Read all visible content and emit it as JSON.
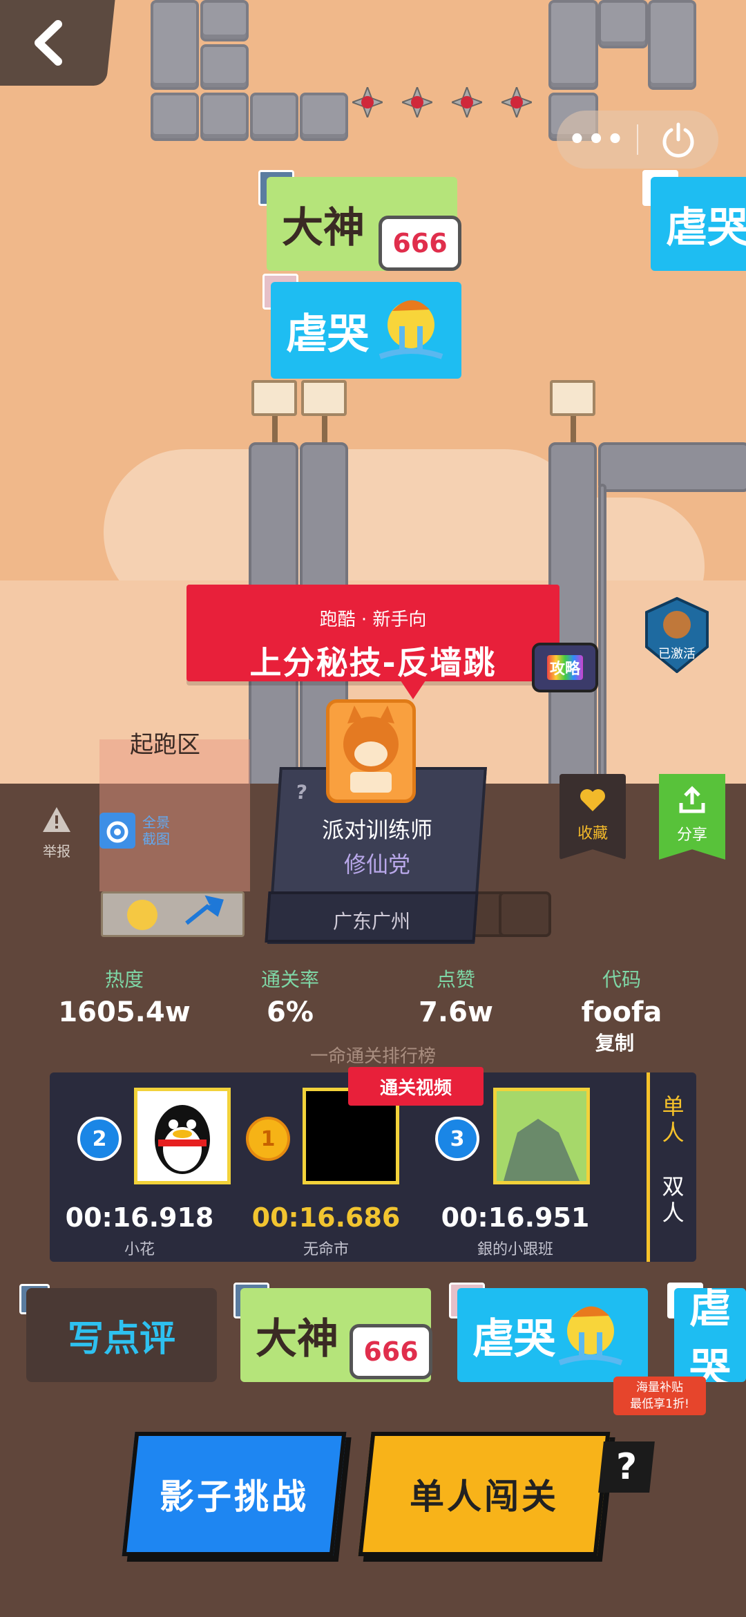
{
  "scene": {
    "start_zone_label": "起跑区",
    "danmu": [
      {
        "text": "大神",
        "sticker": "666",
        "style": "green"
      },
      {
        "text": "虐哭",
        "style": "cyan"
      },
      {
        "text": "虐哭",
        "style": "cyan"
      }
    ],
    "banner": {
      "subtitle": "跑酷 · 新手向",
      "title": "上分秘技-反墙跳"
    },
    "tv_label": "攻略",
    "activated_badge": "已激活"
  },
  "capsule": {
    "more": "•••"
  },
  "tools": {
    "report_label": "举报",
    "screenshot_label_1": "全景",
    "screenshot_label_2": "截图"
  },
  "creator": {
    "unknown_mark": "?",
    "name": "派对训练师",
    "team": "修仙党",
    "location": "广东广州"
  },
  "actions": {
    "favorite_label": "收藏",
    "share_label": "分享"
  },
  "stats": [
    {
      "key": "热度",
      "value": "1605.4w"
    },
    {
      "key": "通关率",
      "value": "6%"
    },
    {
      "key": "点赞",
      "value": "7.6w"
    },
    {
      "key": "代码",
      "value": "foofa"
    }
  ],
  "copy_label": "复制",
  "ranking": {
    "title": "一命通关排行榜",
    "video_tag": "通关视频",
    "entries": [
      {
        "rank": "2",
        "time": "00:16.918",
        "name": "小花"
      },
      {
        "rank": "1",
        "time": "00:16.686",
        "name": "无命市"
      },
      {
        "rank": "3",
        "time": "00:16.951",
        "name": "銀的小跟班"
      }
    ],
    "modes": [
      "单人",
      "双人"
    ]
  },
  "review_label": "写点评",
  "bottom_danmu": [
    {
      "text": "大神",
      "sticker": "666"
    },
    {
      "text": "虐哭"
    },
    {
      "text": "虐哭"
    }
  ],
  "promo": {
    "line1": "海量补贴",
    "line2": "最低享1折!"
  },
  "buttons": {
    "shadow_challenge": "影子挑战",
    "solo": "单人闯关",
    "help": "?"
  },
  "colors": {
    "accent_red": "#e8203a",
    "gold": "#f6c22a",
    "stat_key": "#7ed7a6",
    "blue_button": "#1e86f2",
    "yellow_button": "#f8b319"
  }
}
